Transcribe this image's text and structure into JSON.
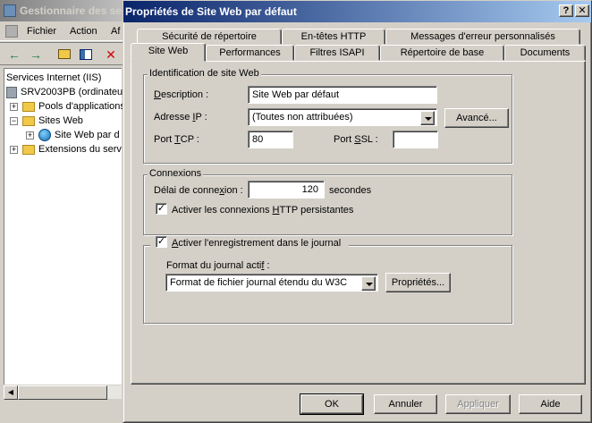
{
  "background_window": {
    "title": "Gestionnaire des se",
    "menu": [
      "Fichier",
      "Action",
      "Af"
    ],
    "tree": [
      {
        "label": "Services Internet (IIS)"
      },
      {
        "label": "SRV2003PB (ordinateu"
      },
      {
        "label": "Pools d'applications"
      },
      {
        "label": "Sites Web"
      },
      {
        "label": "Site Web par d"
      },
      {
        "label": "Extensions du serv"
      }
    ]
  },
  "dialog": {
    "title": "Propriétés de Site Web par défaut",
    "help_glyph": "?",
    "close_glyph": "✕",
    "tabs_row1": [
      "Sécurité de répertoire",
      "En-têtes HTTP",
      "Messages d'erreur personnalisés"
    ],
    "tabs_row2": [
      "Site Web",
      "Performances",
      "Filtres ISAPI",
      "Répertoire de base",
      "Documents"
    ],
    "active_tab": "Site Web",
    "identification": {
      "legend": "Identification de site Web",
      "description_label": "Description :",
      "description_value": "Site Web par défaut",
      "ip_label": "Adresse IP :",
      "ip_value": "(Toutes non attribuées)",
      "advanced_button": "Avancé...",
      "tcp_label": "Port TCP :",
      "tcp_value": "80",
      "ssl_label": "Port SSL :",
      "ssl_value": ""
    },
    "connections": {
      "legend": "Connexions",
      "timeout_label": "Délai de connexion :",
      "timeout_value": "120",
      "timeout_unit": "secondes",
      "keepalive_label": "Activer les connexions HTTP persistantes",
      "keepalive_checked": true
    },
    "logging": {
      "enable_label": "Activer l'enregistrement dans le journal",
      "enable_checked": true,
      "format_label": "Format du journal actif :",
      "format_value": "Format de fichier journal étendu du W3C",
      "properties_button": "Propriétés..."
    },
    "buttons": {
      "ok": "OK",
      "cancel": "Annuler",
      "apply": "Appliquer",
      "help": "Aide"
    }
  }
}
